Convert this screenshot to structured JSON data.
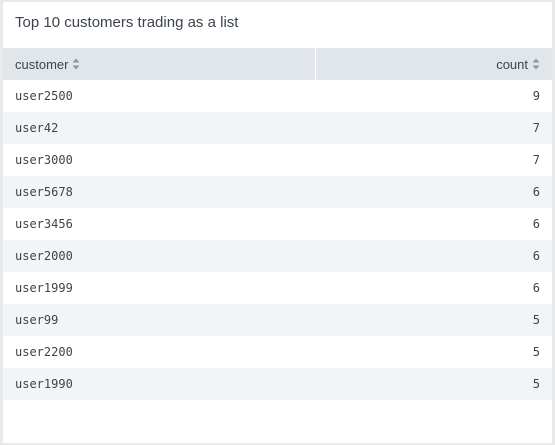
{
  "panel": {
    "title": "Top 10 customers trading as a list"
  },
  "table": {
    "columns": [
      {
        "label": "customer",
        "icon": "sort-icon"
      },
      {
        "label": "count",
        "icon": "sort-icon"
      }
    ],
    "rows": [
      {
        "customer": "user2500",
        "count": "9"
      },
      {
        "customer": "user42",
        "count": "7"
      },
      {
        "customer": "user3000",
        "count": "7"
      },
      {
        "customer": "user5678",
        "count": "6"
      },
      {
        "customer": "user3456",
        "count": "6"
      },
      {
        "customer": "user2000",
        "count": "6"
      },
      {
        "customer": "user1999",
        "count": "6"
      },
      {
        "customer": "user99",
        "count": "5"
      },
      {
        "customer": "user2200",
        "count": "5"
      },
      {
        "customer": "user1990",
        "count": "5"
      }
    ]
  },
  "colors": {
    "header_bg": "#e1e6eb",
    "row_alt_bg": "#f2f4f5",
    "text": "#3c444d"
  }
}
